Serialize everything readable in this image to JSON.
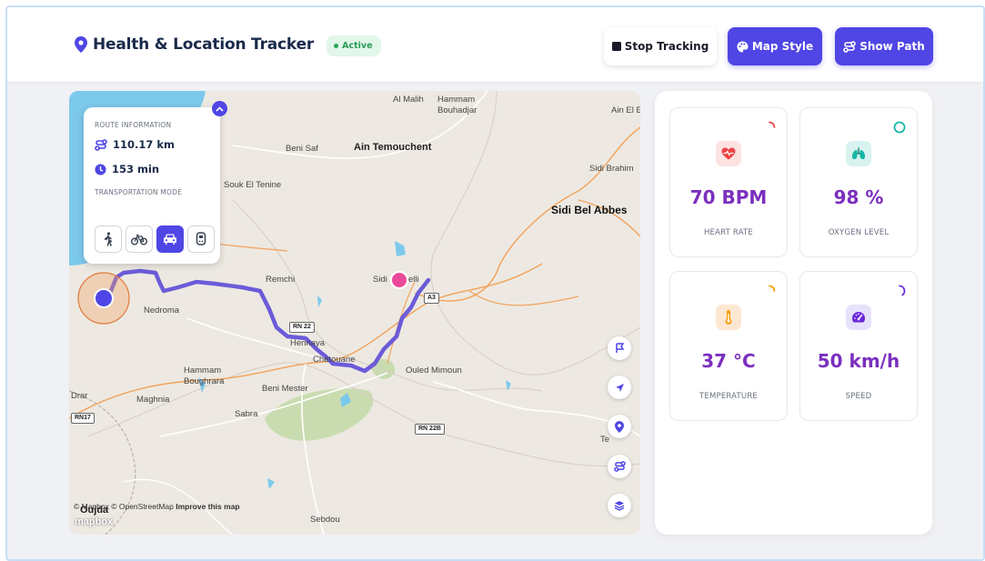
{
  "header": {
    "title": "Health & Location Tracker",
    "status": "Active",
    "buttons": {
      "stop": "Stop Tracking",
      "style": "Map Style",
      "path": "Show Path"
    }
  },
  "route": {
    "section_label": "ROUTE INFORMATION",
    "distance": "110.17 km",
    "duration": "153 min",
    "mode_label": "TRANSPORTATION MODE",
    "modes": [
      "walk-icon",
      "bike-icon",
      "car-icon",
      "transit-icon"
    ],
    "active_mode": "car"
  },
  "map": {
    "labels": {
      "al_malih": "Al Malih",
      "hammam_bouhadjar_1": "Hammam",
      "hammam_bouhadjar_2": "Bouhadjar",
      "ain_el": "Ain El E",
      "beni_saf": "Beni Saf",
      "ain_temouchent": "Ain Temouchent",
      "sidi_brahim": "Sidi Brahim",
      "souk_el_tenine": "Souk El Tenine",
      "sidi_bel_abbes": "Sidi Bel Abbes",
      "remchi": "Remchi",
      "sidi_ali": "Sidi",
      "sidi_ali_2": "elli",
      "nedroma": "Nedroma",
      "hennaya": "Hennaya",
      "chetouane": "Chetouane",
      "ouled_mimoun": "Ouled Mimoun",
      "hammam_boughrara_1": "Hammam",
      "hammam_boughrara_2": "Boughrara",
      "beni_mester": "Beni Mester",
      "drar": "Drar",
      "maghnia": "Maghnia",
      "sabra": "Sabra",
      "te": "Te",
      "oujda": "Oujda",
      "sebdou": "Sebdou"
    },
    "shields": {
      "a3": "A3",
      "rn22": "RN 22",
      "rn17": "RN17",
      "rn22b": "RN 22B"
    },
    "attribution": "© Mapbox © OpenStreetMap",
    "improve": "Improve this map",
    "logo": "mapbox",
    "controls": [
      "flag-icon",
      "navigate-icon",
      "location-pin-icon",
      "route-icon",
      "layers-icon"
    ]
  },
  "stats": [
    {
      "value": "70 BPM",
      "label": "HEART RATE",
      "color": "#7b2fbe",
      "icon": "heart-pulse-icon",
      "icon_bg": "#fde2e2",
      "ring_color": "#ef4444",
      "ring_fraction": 0.25
    },
    {
      "value": "98 %",
      "label": "OXYGEN LEVEL",
      "color": "#7b2fbe",
      "icon": "lungs-icon",
      "icon_bg": "#d8f3ef",
      "ring_color": "#14b8a6",
      "ring_fraction": 0.98
    },
    {
      "value": "37 °C",
      "label": "TEMPERATURE",
      "color": "#7b2fbe",
      "icon": "thermometer-icon",
      "icon_bg": "#fde7d2",
      "ring_color": "#f59e0b",
      "ring_fraction": 0.25
    },
    {
      "value": "50 km/h",
      "label": "SPEED",
      "color": "#7b2fbe",
      "icon": "speedometer-icon",
      "icon_bg": "#e6e2fb",
      "ring_color": "#6d28d9",
      "ring_fraction": 0.4
    }
  ],
  "colors": {
    "accent": "#4f46e5",
    "route": "#6b5bd9",
    "active": "#2aa55a"
  }
}
